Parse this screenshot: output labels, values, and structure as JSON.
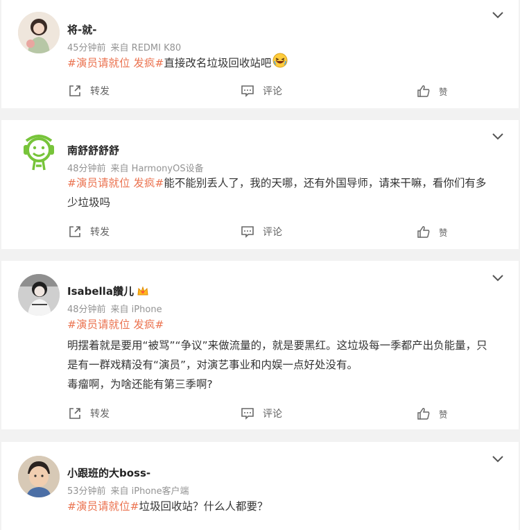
{
  "posts": [
    {
      "username": "将-就-",
      "time": "45分钟前",
      "source": "来自 REDMI K80",
      "topics": "#演员请就位 发疯#",
      "text": "直接改名垃圾回收站吧",
      "actions": {
        "repost": "转发",
        "comment": "评论",
        "like": "赞"
      }
    },
    {
      "username": "南舒舒舒舒",
      "time": "48分钟前",
      "source": "来自 HarmonyOS设备",
      "topics": "#演员请就位 发疯#",
      "text_line1": "能不能别丢人了，我的天哪，还有外国导师，请来干嘛，看你们有多",
      "text_line2": "少垃圾吗",
      "actions": {
        "repost": "转发",
        "comment": "评论",
        "like": "赞"
      }
    },
    {
      "username": "Isabella饡儿",
      "time": "48分钟前",
      "source": "来自 iPhone",
      "topics": "#演员请就位 发疯#",
      "text_line1": "明摆着就是要用“被骂”“争议”来做流量的，就是要黑红。这垃圾每一季都产出负能量，只",
      "text_line2": "是有一群戏精没有“演员”，对演艺事业和内娱一点好处没有。",
      "text_line3": "毒瘤啊，为啥还能有第三季啊?",
      "actions": {
        "repost": "转发",
        "comment": "评论",
        "like": "赞"
      }
    },
    {
      "username": "小跟班的大boss-",
      "time": "53分钟前",
      "source": "来自 iPhone客户端",
      "topics": "#演员请就位#",
      "text": "垃圾回收站？什么人都要？"
    }
  ],
  "icons": {
    "menu": "chevron-down-icon",
    "repost": "share-icon",
    "comment": "comment-icon",
    "like": "thumb-up-icon",
    "badge": "crown-badge-icon",
    "emoji": "laughing-emoji-icon"
  },
  "colors": {
    "topic": "#eb7350",
    "meta": "#939393",
    "background": "#f2f2f2"
  }
}
